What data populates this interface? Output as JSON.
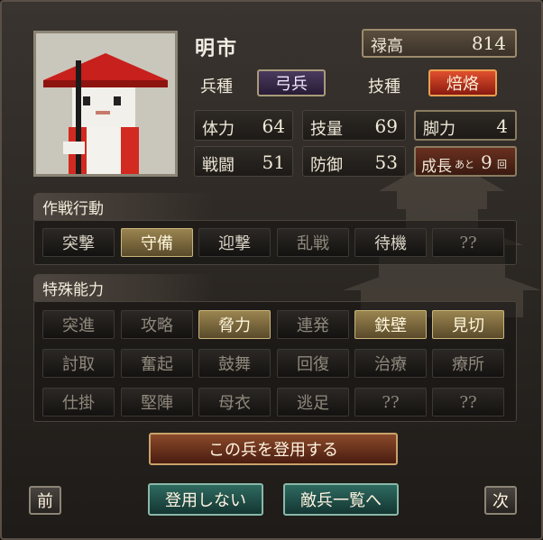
{
  "unit": {
    "name": "明市",
    "salary_label": "禄高",
    "salary": "814",
    "unit_type_label": "兵種",
    "unit_type": "弓兵",
    "skill_type_label": "技種",
    "skill_type": "焙烙",
    "stats": [
      {
        "label": "体力",
        "value": "64"
      },
      {
        "label": "技量",
        "value": "69"
      },
      {
        "label": "脚力",
        "value": "4"
      },
      {
        "label": "戦闘",
        "value": "51"
      },
      {
        "label": "防御",
        "value": "53"
      }
    ],
    "growth_label": "成長",
    "growth_prefix": "あと",
    "growth_value": "9",
    "growth_suffix": "回"
  },
  "tactics": {
    "title": "作戦行動",
    "items": [
      {
        "label": "突撃",
        "state": "off"
      },
      {
        "label": "守備",
        "state": "on"
      },
      {
        "label": "迎撃",
        "state": "off"
      },
      {
        "label": "乱戦",
        "state": "dim"
      },
      {
        "label": "待機",
        "state": "off"
      },
      {
        "label": "??",
        "state": "dim"
      }
    ]
  },
  "abilities": {
    "title": "特殊能力",
    "items": [
      {
        "label": "突進",
        "state": "dim"
      },
      {
        "label": "攻略",
        "state": "dim"
      },
      {
        "label": "脅力",
        "state": "on"
      },
      {
        "label": "連発",
        "state": "dim"
      },
      {
        "label": "鉄壁",
        "state": "on"
      },
      {
        "label": "見切",
        "state": "on"
      },
      {
        "label": "討取",
        "state": "dim"
      },
      {
        "label": "奮起",
        "state": "dim"
      },
      {
        "label": "鼓舞",
        "state": "dim"
      },
      {
        "label": "回復",
        "state": "dim"
      },
      {
        "label": "治療",
        "state": "dim"
      },
      {
        "label": "療所",
        "state": "dim"
      },
      {
        "label": "仕掛",
        "state": "dim"
      },
      {
        "label": "堅陣",
        "state": "dim"
      },
      {
        "label": "母衣",
        "state": "dim"
      },
      {
        "label": "逃足",
        "state": "dim"
      },
      {
        "label": "??",
        "state": "dim"
      },
      {
        "label": "??",
        "state": "dim"
      }
    ]
  },
  "actions": {
    "recruit": "この兵を登用する",
    "decline": "登用しない",
    "enemy_list": "敵兵一覧へ",
    "prev": "前",
    "next": "次"
  },
  "colors": {
    "gold": "#9a8550",
    "skill_red": "#c8402a",
    "unit_purple": "#3a2a4a",
    "recruit_brown": "#7a3a22",
    "teal": "#1f4c48"
  }
}
